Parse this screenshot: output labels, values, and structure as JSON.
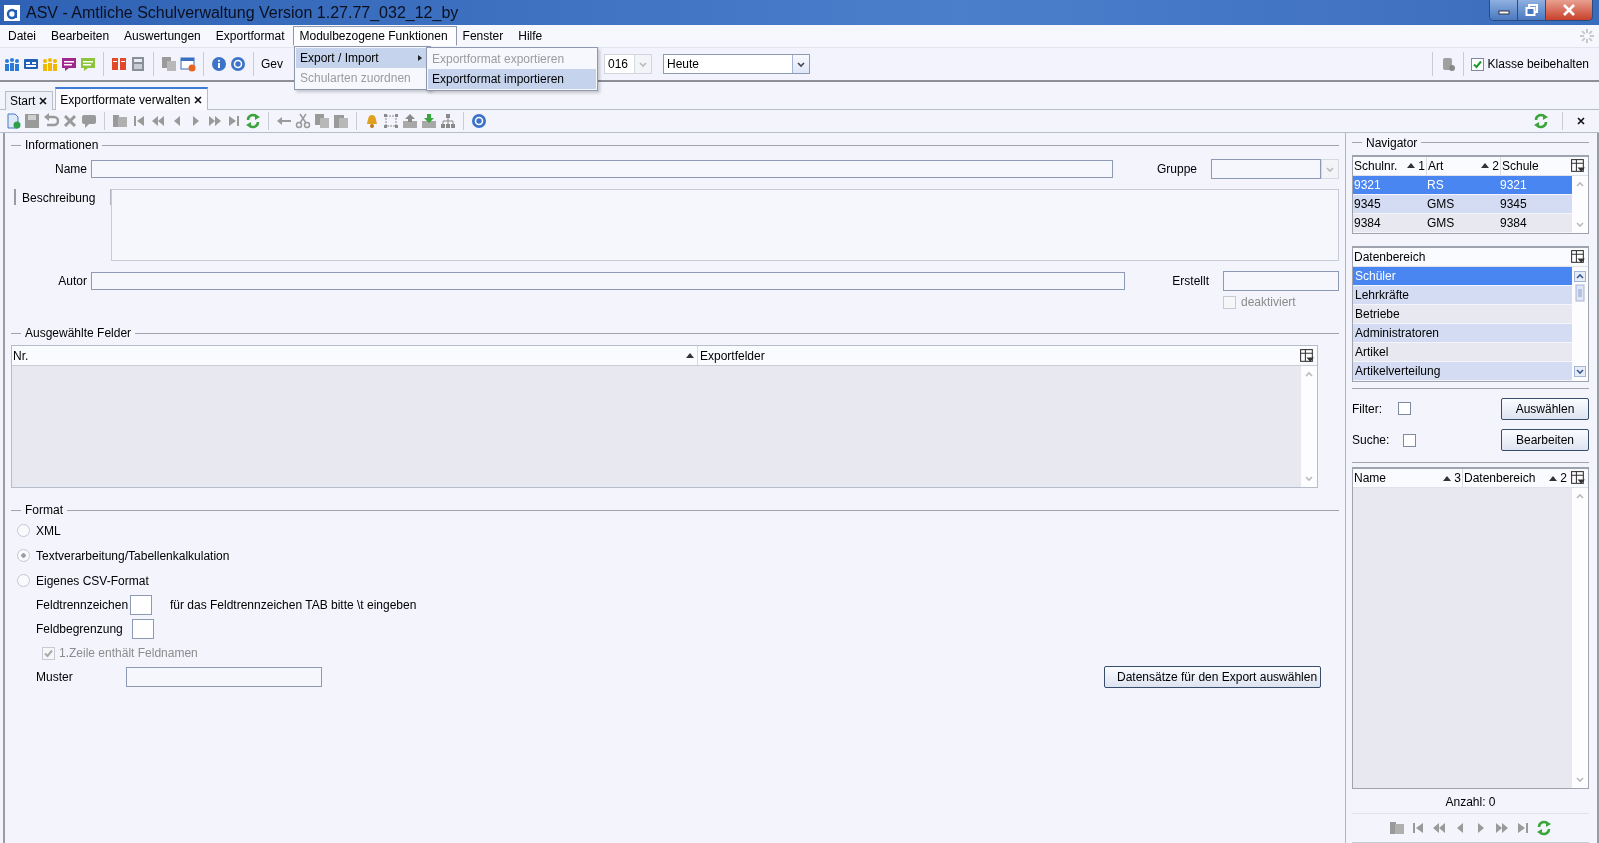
{
  "window": {
    "title": "ASV - Amtliche Schulverwaltung Version 1.27.77_032_12_by"
  },
  "menu_bar": [
    {
      "label": "Datei",
      "selected": false
    },
    {
      "label": "Bearbeiten",
      "selected": false
    },
    {
      "label": "Auswertungen",
      "selected": false
    },
    {
      "label": "Exportformat",
      "selected": false
    },
    {
      "label": "Modulbezogene Funktionen",
      "selected": true
    },
    {
      "label": "Fenster",
      "selected": false
    },
    {
      "label": "Hilfe",
      "selected": false
    }
  ],
  "open_menu": {
    "items": [
      {
        "label": "Export / Import",
        "selected": true,
        "disabled": false,
        "has_submenu": true
      },
      {
        "label": "Schularten zuordnen",
        "selected": false,
        "disabled": true,
        "has_submenu": false
      }
    ],
    "submenu": [
      {
        "label": "Exportformat exportieren",
        "selected": false,
        "disabled": true
      },
      {
        "label": "Exportformat importieren",
        "selected": true,
        "disabled": false
      }
    ]
  },
  "toolbar": {
    "label": "Gev",
    "date_field": {
      "value": "016"
    },
    "period_field": {
      "value": "Heute"
    },
    "keep_class": {
      "label": "Klasse beibehalten",
      "checked": true
    }
  },
  "tabs": [
    {
      "label": "Start",
      "selected": false
    },
    {
      "label": "Exportformate verwalten",
      "selected": true
    }
  ],
  "informationen": {
    "title": "Informationen",
    "name_label": "Name",
    "gruppe_label": "Gruppe",
    "beschreibung_label": "Beschreibung",
    "autor_label": "Autor",
    "erstellt_label": "Erstellt",
    "deaktiviert": {
      "label": "deaktiviert",
      "checked": false,
      "disabled": true
    }
  },
  "ausgewaehlte_felder": {
    "title": "Ausgewählte Felder",
    "columns": [
      {
        "label": "Nr.",
        "sorted": true
      },
      {
        "label": "Exportfelder",
        "sorted": false
      }
    ]
  },
  "format": {
    "title": "Format",
    "options": [
      {
        "label": "XML",
        "selected": false
      },
      {
        "label": "Textverarbeitung/Tabellenkalkulation",
        "selected": true
      },
      {
        "label": "Eigenes CSV-Format",
        "selected": false
      }
    ],
    "separator_label": "Feldtrennzeichen",
    "separator_hint": "für das Feldtrennzeichen TAB bitte \\t eingeben",
    "delimiter_label": "Feldbegrenzung",
    "header_row": {
      "label": "1.Zeile enthält Feldnamen",
      "checked": true,
      "disabled": true
    },
    "pattern_label": "Muster",
    "export_button": "Datensätze für den Export auswählen"
  },
  "navigator": {
    "title": "Navigator",
    "schools": {
      "columns": [
        {
          "label": "Schulnr.",
          "sort_rank": "1"
        },
        {
          "label": "Art",
          "sort_rank": "2"
        },
        {
          "label": "Schule"
        }
      ],
      "rows": [
        {
          "cells": [
            "9321",
            "RS",
            "9321"
          ],
          "selected": true
        },
        {
          "cells": [
            "9345",
            "GMS",
            "9345"
          ],
          "selected": false
        },
        {
          "cells": [
            "9384",
            "GMS",
            "9384"
          ],
          "selected": false
        }
      ]
    },
    "data_areas": {
      "column": "Datenbereich",
      "items": [
        {
          "label": "Schüler",
          "selected": true
        },
        {
          "label": "Lehrkräfte",
          "selected": false
        },
        {
          "label": "Betriebe",
          "selected": false
        },
        {
          "label": "Administratoren",
          "selected": false
        },
        {
          "label": "Artikel",
          "selected": false
        },
        {
          "label": "Artikelverteilung",
          "selected": false
        }
      ]
    },
    "filter": {
      "label": "Filter:",
      "checked": false
    },
    "search": {
      "label": "Suche:",
      "checked": false
    },
    "buttons": [
      "Auswählen",
      "Bearbeiten"
    ],
    "results": {
      "columns": [
        {
          "label": "Name",
          "sort_rank": "3"
        },
        {
          "label": "Datenbereich",
          "sort_rank": "2"
        }
      ]
    },
    "count": "Anzahl: 0"
  }
}
